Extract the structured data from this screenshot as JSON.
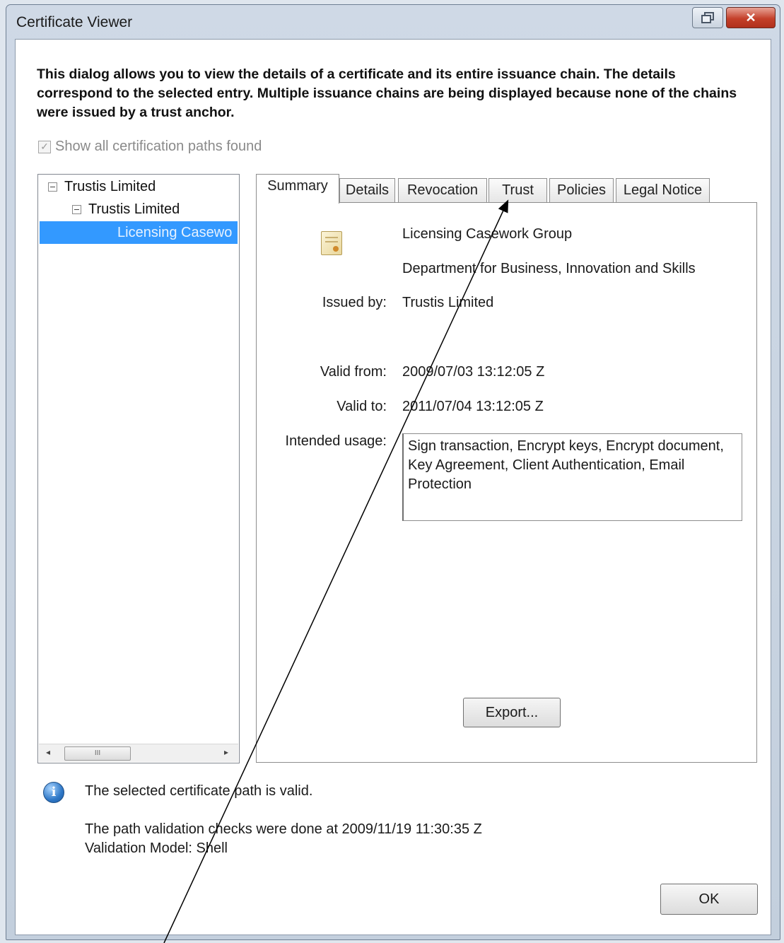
{
  "window": {
    "title": "Certificate Viewer",
    "close_glyph": "✕"
  },
  "intro_text": "This dialog allows you to view the details of a certificate and its entire issuance chain. The details correspond to the selected entry. Multiple issuance chains are being displayed because none of the chains were issued by a trust anchor.",
  "show_all_paths": {
    "label": "Show all certification paths found",
    "checked": true
  },
  "tree": {
    "nodes": [
      {
        "label": "Trustis Limited"
      },
      {
        "label": "Trustis Limited"
      }
    ],
    "selected": "Licensing Casewo",
    "scroll_left": "◂",
    "scroll_right": "▸",
    "scroll_grip": "III"
  },
  "tabs": [
    "Summary",
    "Details",
    "Revocation",
    "Trust",
    "Policies",
    "Legal Notice"
  ],
  "summary": {
    "subject_name": "Licensing Casework Group",
    "subject_org": "Department for Business, Innovation and Skills",
    "issued_by_label": "Issued by:",
    "issued_by": "Trustis Limited",
    "valid_from_label": "Valid from:",
    "valid_from": "2009/07/03 13:12:05 Z",
    "valid_to_label": "Valid to:",
    "valid_to": "2011/07/04 13:12:05 Z",
    "usage_label": "Intended usage:",
    "usage": "Sign transaction, Encrypt keys, Encrypt document, Key Agreement, Client Authentication, Email Protection",
    "export_label": "Export..."
  },
  "status": {
    "icon_glyph": "i",
    "valid_text": "The selected certificate path is valid.",
    "checks_text": "The path validation checks were done at 2009/11/19 11:30:35 Z",
    "model_text": "Validation Model: Shell"
  },
  "ok_label": "OK",
  "colors": {
    "selection": "#3399ff",
    "close_button": "#c4402a"
  }
}
